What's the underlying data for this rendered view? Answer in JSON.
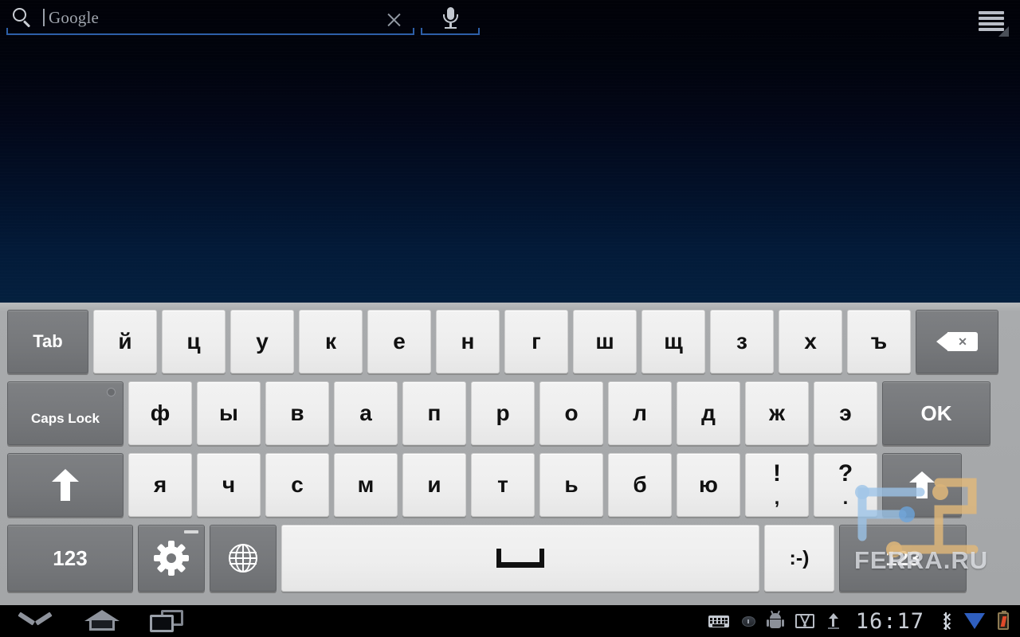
{
  "search": {
    "placeholder": "Google",
    "icon": "search-icon",
    "clear_icon": "close-icon",
    "mic_icon": "microphone-icon",
    "accent_color": "#2d5fa8"
  },
  "app_menu": {
    "icon": "hamburger-menu-icon"
  },
  "keyboard": {
    "language": "Russian (ЙЦУКЕН)",
    "background_color": "#a4a6a8",
    "light_key_color": "#eeeeee",
    "dark_key_color": "#76787b",
    "rows": [
      {
        "name": "row-1",
        "keys": [
          {
            "label": "Tab",
            "name": "key-tab",
            "type": "dark",
            "width": "w-tab"
          },
          {
            "label": "й",
            "name": "key-ya-short",
            "type": "light",
            "width": "w-letter"
          },
          {
            "label": "ц",
            "name": "key-tse",
            "type": "light",
            "width": "w-letter"
          },
          {
            "label": "у",
            "name": "key-u",
            "type": "light",
            "width": "w-letter"
          },
          {
            "label": "к",
            "name": "key-ka",
            "type": "light",
            "width": "w-letter"
          },
          {
            "label": "е",
            "name": "key-ye",
            "type": "light",
            "width": "w-letter"
          },
          {
            "label": "н",
            "name": "key-en",
            "type": "light",
            "width": "w-letter"
          },
          {
            "label": "г",
            "name": "key-ghe",
            "type": "light",
            "width": "w-letter"
          },
          {
            "label": "ш",
            "name": "key-sha",
            "type": "light",
            "width": "w-letter"
          },
          {
            "label": "щ",
            "name": "key-shcha",
            "type": "light",
            "width": "w-letter"
          },
          {
            "label": "з",
            "name": "key-ze",
            "type": "light",
            "width": "w-letter"
          },
          {
            "label": "х",
            "name": "key-ha",
            "type": "light",
            "width": "w-letter"
          },
          {
            "label": "ъ",
            "name": "key-hard-sign",
            "type": "light",
            "width": "w-letter"
          },
          {
            "label": "",
            "name": "key-backspace",
            "type": "dark",
            "width": "w-bksp",
            "glyph": "backspace-icon"
          }
        ]
      },
      {
        "name": "row-2",
        "keys": [
          {
            "label": "Caps Lock",
            "name": "key-caps-lock",
            "type": "dark",
            "width": "w-caps",
            "glyph": "caps-lock-led"
          },
          {
            "label": "ф",
            "name": "key-ef",
            "type": "light",
            "width": "w-l2"
          },
          {
            "label": "ы",
            "name": "key-yeru",
            "type": "light",
            "width": "w-l2"
          },
          {
            "label": "в",
            "name": "key-ve",
            "type": "light",
            "width": "w-l2"
          },
          {
            "label": "а",
            "name": "key-a",
            "type": "light",
            "width": "w-l2"
          },
          {
            "label": "п",
            "name": "key-pe",
            "type": "light",
            "width": "w-l2"
          },
          {
            "label": "р",
            "name": "key-er",
            "type": "light",
            "width": "w-l2"
          },
          {
            "label": "о",
            "name": "key-o",
            "type": "light",
            "width": "w-l2"
          },
          {
            "label": "л",
            "name": "key-el",
            "type": "light",
            "width": "w-l2"
          },
          {
            "label": "д",
            "name": "key-de",
            "type": "light",
            "width": "w-l2"
          },
          {
            "label": "ж",
            "name": "key-zhe",
            "type": "light",
            "width": "w-l2"
          },
          {
            "label": "э",
            "name": "key-e-reversed",
            "type": "light",
            "width": "w-l2"
          },
          {
            "label": "OK",
            "name": "key-ok",
            "type": "dark",
            "width": "w-ok"
          }
        ]
      },
      {
        "name": "row-3",
        "keys": [
          {
            "label": "",
            "name": "key-shift-left",
            "type": "dark",
            "width": "w-shift",
            "glyph": "arrow-up-icon"
          },
          {
            "label": "я",
            "name": "key-ya",
            "type": "light",
            "width": "w-l3"
          },
          {
            "label": "ч",
            "name": "key-che",
            "type": "light",
            "width": "w-l3"
          },
          {
            "label": "с",
            "name": "key-es",
            "type": "light",
            "width": "w-l3"
          },
          {
            "label": "м",
            "name": "key-em",
            "type": "light",
            "width": "w-l3"
          },
          {
            "label": "и",
            "name": "key-i",
            "type": "light",
            "width": "w-l3"
          },
          {
            "label": "т",
            "name": "key-te",
            "type": "light",
            "width": "w-l3"
          },
          {
            "label": "ь",
            "name": "key-soft-sign",
            "type": "light",
            "width": "w-l3"
          },
          {
            "label": "б",
            "name": "key-be",
            "type": "light",
            "width": "w-l3"
          },
          {
            "label": "ю",
            "name": "key-yu",
            "type": "light",
            "width": "w-l3"
          },
          {
            "label": "!",
            "sublabel": ",",
            "name": "key-exclamation-comma",
            "type": "light",
            "width": "w-l3",
            "glyph": "punct"
          },
          {
            "label": "?",
            "sublabel": ".",
            "name": "key-question-period",
            "type": "light",
            "width": "w-l3",
            "glyph": "punct"
          },
          {
            "label": "",
            "name": "key-shift-right",
            "type": "dark",
            "width": "w-rshift",
            "glyph": "arrow-up-icon"
          }
        ]
      },
      {
        "name": "row-4",
        "keys": [
          {
            "label": "123",
            "name": "key-numeric-left",
            "type": "dark",
            "width": "w-123"
          },
          {
            "label": "",
            "name": "key-settings",
            "type": "dark",
            "width": "w-fn",
            "glyph": "gear-icon"
          },
          {
            "label": "",
            "name": "key-language",
            "type": "dark",
            "width": "w-fn",
            "glyph": "globe-icon"
          },
          {
            "label": "",
            "name": "key-space",
            "type": "light",
            "width": "w-space",
            "glyph": "space-icon"
          },
          {
            "label": ":-)",
            "name": "key-emoji",
            "type": "light",
            "width": "w-emoji"
          },
          {
            "label": "123",
            "name": "key-numeric-right",
            "type": "dark",
            "width": "w-123b"
          }
        ]
      }
    ]
  },
  "watermark": {
    "text": "FERRA.RU"
  },
  "navbar": {
    "left_buttons": [
      {
        "name": "nav-back-hide-keyboard",
        "icon": "chevron-down-icon"
      },
      {
        "name": "nav-home",
        "icon": "home-icon"
      },
      {
        "name": "nav-recents",
        "icon": "recent-apps-icon"
      }
    ],
    "status_icons": [
      {
        "name": "keyboard-status-icon",
        "icon": "keyboard-icon"
      },
      {
        "name": "mouse-status-icon",
        "icon": "mouse-icon"
      },
      {
        "name": "android-status-icon",
        "icon": "android-robot-icon"
      },
      {
        "name": "gmail-status-icon",
        "icon": "gmail-icon"
      },
      {
        "name": "upload-status-icon",
        "icon": "upload-arrow-icon"
      }
    ],
    "clock": "16:17",
    "right_icons": [
      {
        "name": "bluetooth-icon",
        "icon": "bluetooth-icon"
      },
      {
        "name": "wifi-icon",
        "icon": "wifi-icon"
      },
      {
        "name": "battery-icon",
        "icon": "battery-charging-icon"
      }
    ]
  }
}
